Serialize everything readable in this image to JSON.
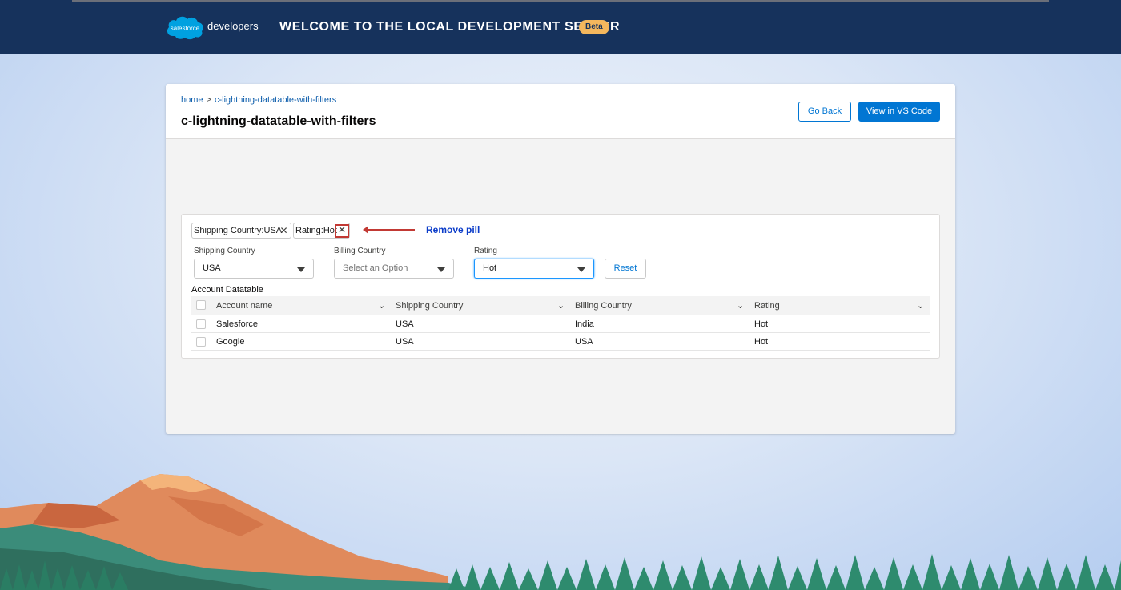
{
  "header": {
    "logo_text": "salesforce",
    "brand_suffix": "developers",
    "title": "WELCOME TO THE LOCAL DEVELOPMENT SERVER",
    "badge": "Beta"
  },
  "breadcrumb": {
    "home": "home",
    "separator": ">",
    "current": "c-lightning-datatable-with-filters"
  },
  "page": {
    "title": "c-lightning-datatable-with-filters",
    "go_back_label": "Go Back",
    "view_code_label": "View in VS Code"
  },
  "pills": [
    {
      "label": "Shipping Country:USA",
      "icon": "close-icon"
    },
    {
      "label": "Rating:Hot",
      "icon": "close-icon"
    }
  ],
  "annotation": {
    "text": "Remove pill",
    "color": "#0b3cc9",
    "arrow_color": "#c23934"
  },
  "filters": {
    "shipping": {
      "label": "Shipping Country",
      "value": "USA"
    },
    "billing": {
      "label": "Billing Country",
      "placeholder": "Select an Option"
    },
    "rating": {
      "label": "Rating",
      "value": "Hot"
    },
    "reset_label": "Reset"
  },
  "table": {
    "title": "Account Datatable",
    "columns": [
      "Account name",
      "Shipping Country",
      "Billing Country",
      "Rating"
    ],
    "rows": [
      [
        "Salesforce",
        "USA",
        "India",
        "Hot"
      ],
      [
        "Google",
        "USA",
        "USA",
        "Hot"
      ]
    ]
  },
  "colors": {
    "header_bg": "#16325c",
    "brand_button": "#0176d3",
    "beta_badge": "#f4b75d",
    "link": "#0b5cab"
  }
}
